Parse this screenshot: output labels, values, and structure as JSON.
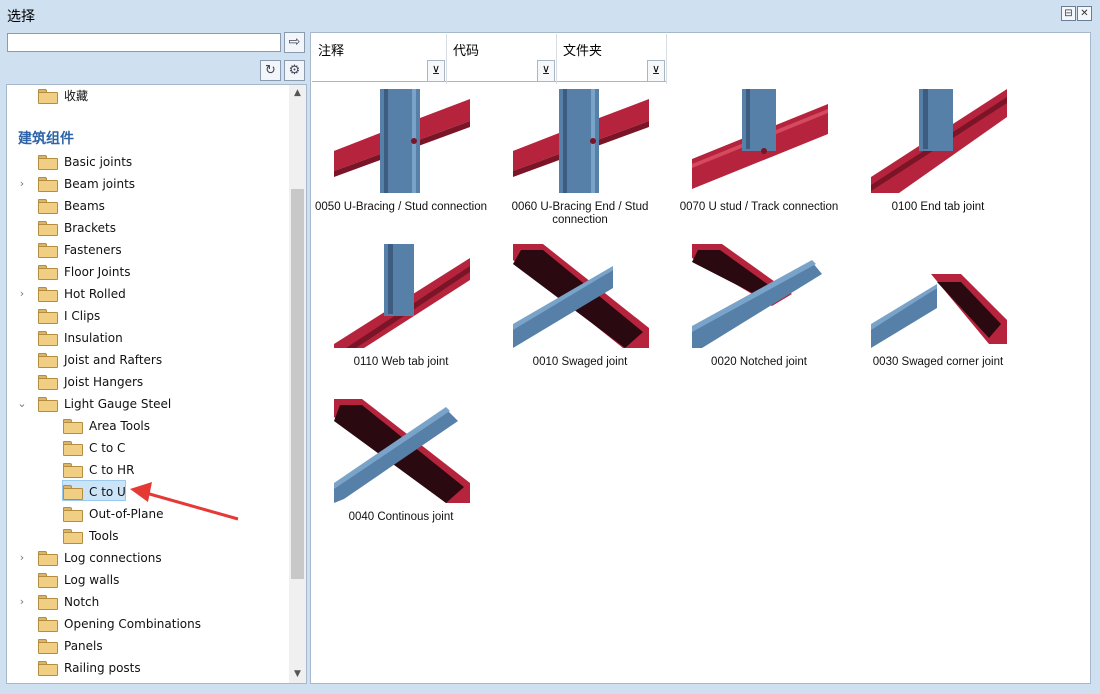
{
  "window": {
    "title": "选择",
    "pin_glyph": "⊟",
    "close_glyph": "✕"
  },
  "left": {
    "search": {
      "value": "",
      "placeholder": ""
    },
    "go_glyph": "⇨",
    "refresh_glyph": "↻",
    "settings_glyph": "⚙",
    "favorites_label": "收藏",
    "group_header": "建筑组件",
    "items": [
      {
        "label": "Basic joints",
        "arrow": ""
      },
      {
        "label": "Beam joints",
        "arrow": "›"
      },
      {
        "label": "Beams",
        "arrow": ""
      },
      {
        "label": "Brackets",
        "arrow": ""
      },
      {
        "label": "Fasteners",
        "arrow": ""
      },
      {
        "label": "Floor Joints",
        "arrow": ""
      },
      {
        "label": "Hot Rolled",
        "arrow": "›"
      },
      {
        "label": "I Clips",
        "arrow": ""
      },
      {
        "label": "Insulation",
        "arrow": ""
      },
      {
        "label": "Joist and Rafters",
        "arrow": ""
      },
      {
        "label": "Joist Hangers",
        "arrow": ""
      },
      {
        "label": "Light Gauge Steel",
        "arrow": "⌄"
      },
      {
        "label": "Log connections",
        "arrow": "›"
      },
      {
        "label": "Log walls",
        "arrow": ""
      },
      {
        "label": "Notch",
        "arrow": "›"
      },
      {
        "label": "Opening Combinations",
        "arrow": ""
      },
      {
        "label": "Panels",
        "arrow": ""
      },
      {
        "label": "Railing posts",
        "arrow": ""
      }
    ],
    "subitems": [
      {
        "label": "Area Tools"
      },
      {
        "label": "C to C"
      },
      {
        "label": "C to HR"
      },
      {
        "label": "C to U",
        "selected": true
      },
      {
        "label": "Out-of-Plane"
      },
      {
        "label": "Tools"
      }
    ],
    "scroll_up": "▲",
    "scroll_down": "▼"
  },
  "right": {
    "columns": [
      {
        "label": "注释"
      },
      {
        "label": "代码"
      },
      {
        "label": "文件夹"
      }
    ],
    "filter_glyph": "⊻",
    "tiles": [
      {
        "caption": "0050 U-Bracing / Stud connection",
        "kind": "stud-beam"
      },
      {
        "caption": "0060 U-Bracing End / Stud connection",
        "kind": "stud-beam"
      },
      {
        "caption": "0070 U stud / Track connection",
        "kind": "stud-track"
      },
      {
        "caption": "0100 End tab joint",
        "kind": "stud-diag"
      },
      {
        "caption": "0110 Web tab joint",
        "kind": "stud-diag2"
      },
      {
        "caption": "0010 Swaged joint",
        "kind": "cross-swaged"
      },
      {
        "caption": "0020 Notched joint",
        "kind": "cross-notched"
      },
      {
        "caption": "0030 Swaged corner joint",
        "kind": "corner"
      },
      {
        "caption": "0040 Continous joint",
        "kind": "cross-cont"
      }
    ]
  },
  "colors": {
    "red": "#b5243c",
    "blue": "#5680a8",
    "accent": "#2e63a8",
    "arrow": "#e53935"
  }
}
